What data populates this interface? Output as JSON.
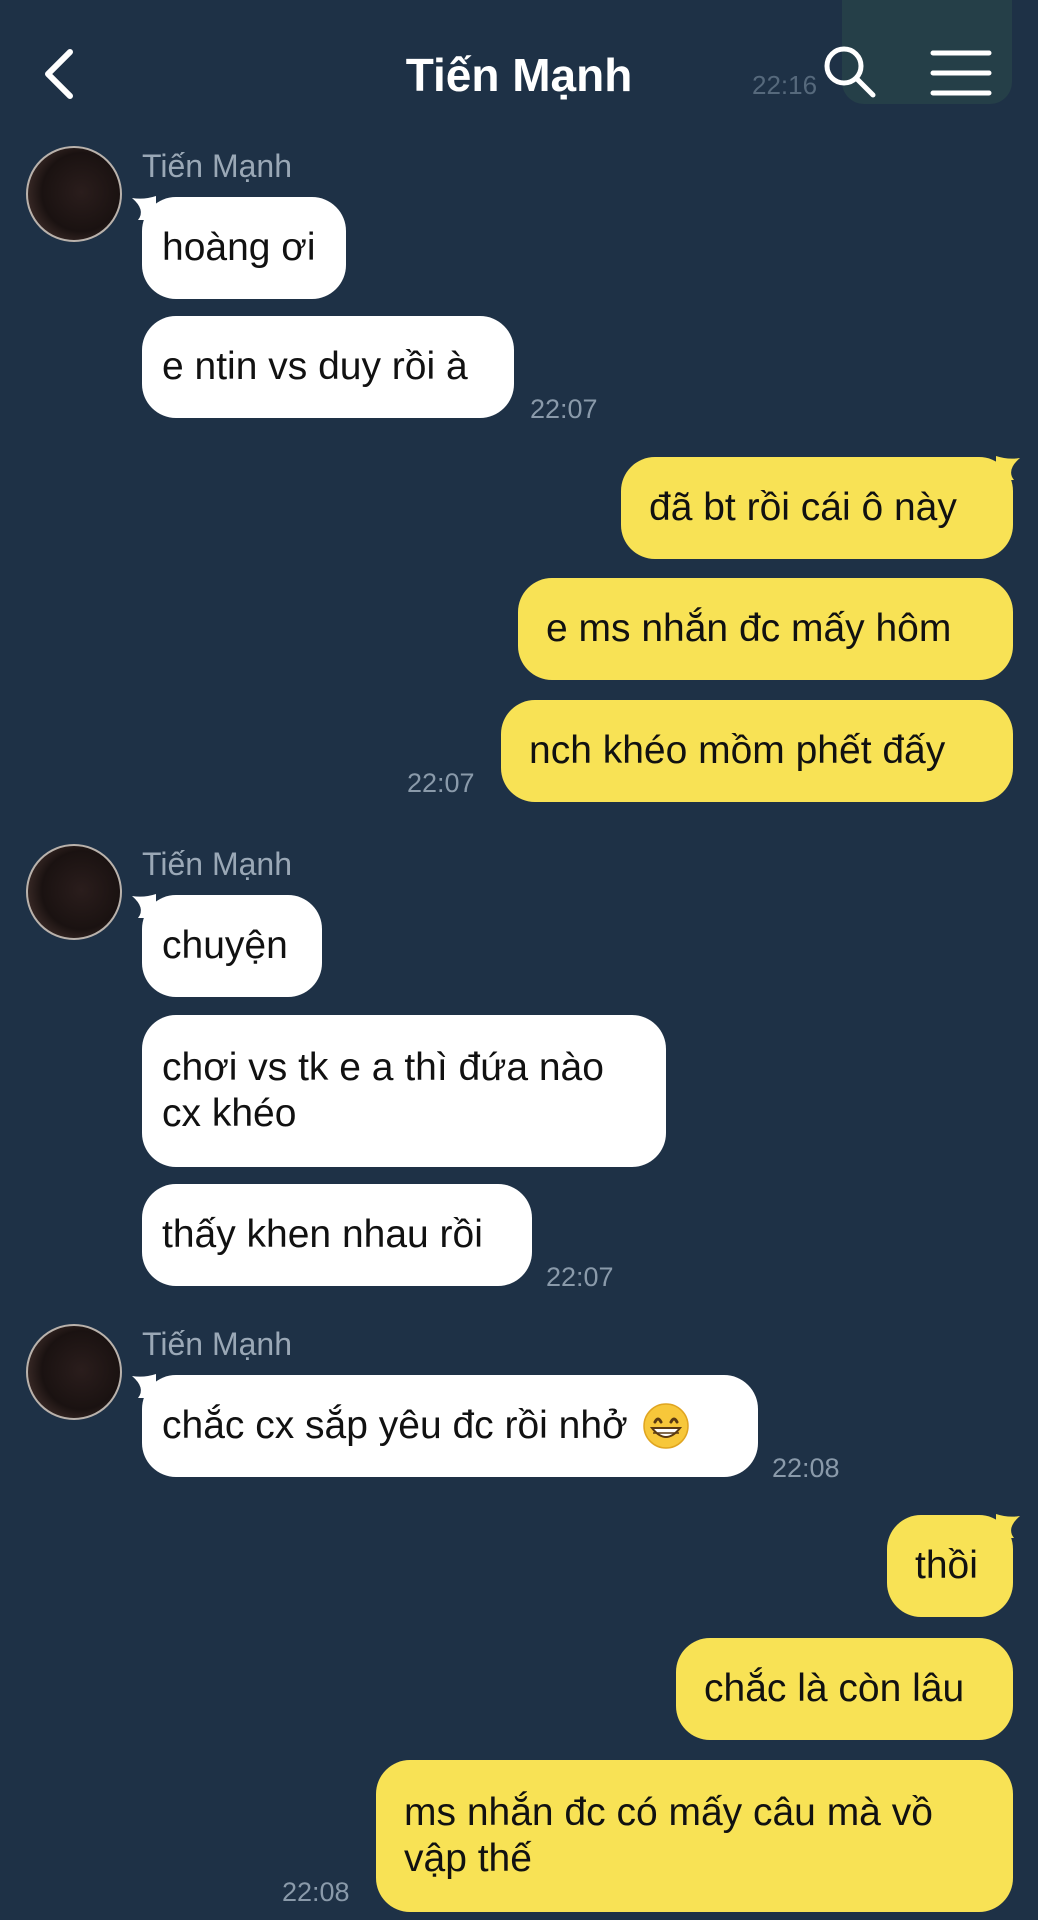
{
  "header": {
    "title": "Tiến Mạnh",
    "back_icon": "chevron-left-icon",
    "search_icon": "search-icon",
    "menu_icon": "hamburger-menu-icon",
    "ghost_time": "22:16"
  },
  "colors": {
    "background": "#1e3146",
    "incoming_bubble": "#ffffff",
    "outgoing_bubble": "#f8e255",
    "timestamp": "#8a9aaa"
  },
  "messages": {
    "g1": {
      "sender": "Tiến Mạnh",
      "m1": "hoàng ơi",
      "m2": "e ntin vs duy rồi à",
      "time": "22:07"
    },
    "g2": {
      "m1": "đã bt rồi cái ô này",
      "m2": "e ms nhắn đc mấy hôm",
      "m3": "nch khéo mồm phết đấy",
      "time": "22:07"
    },
    "g3": {
      "sender": "Tiến Mạnh",
      "m1": "chuyện",
      "m2": "chơi vs tk e a thì đứa nào cx khéo",
      "m3": "thấy khen nhau rồi",
      "time": "22:07"
    },
    "g4": {
      "sender": "Tiến Mạnh",
      "m1": "chắc cx sắp yêu đc rồi nhở",
      "emoji": "grinning-face-icon",
      "time": "22:08"
    },
    "g5": {
      "m1": "thồi",
      "m2": "chắc là còn lâu",
      "m3": "ms nhắn đc có mấy câu mà vồ vập thế",
      "time": "22:08"
    }
  }
}
